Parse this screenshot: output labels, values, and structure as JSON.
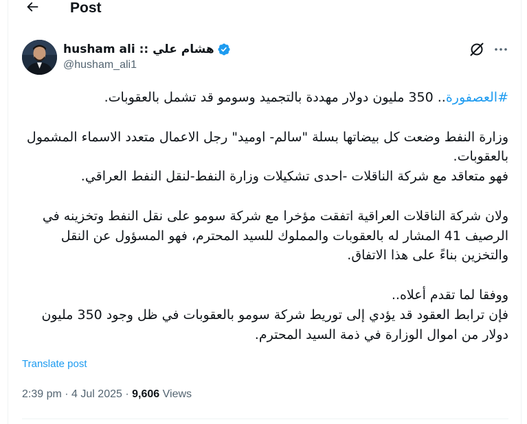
{
  "header": {
    "title": "Post",
    "back_icon": "arrow-left-icon"
  },
  "author": {
    "display_name": "husham ali :: هشام علي",
    "handle": "@husham_ali1",
    "verified_icon": "verified-badge-icon",
    "verified_color": "#1d9bf0"
  },
  "actions": {
    "grok_icon": "grok-icon",
    "more_icon": "more-horizontal-icon"
  },
  "tweet": {
    "hashtag": "#العصفورة",
    "line1_rest": ".. 350 مليون دولار مهددة بالتجميد وسومو قد تشمل بالعقوبات.",
    "para2": "وزارة النفط وضعت كل بيضاتها بسلة \"سالم- اوميد\" رجل الاعمال متعدد الاسماء المشمول بالعقوبات.\nفهو متعاقد مع شركة الناقلات -احدى تشكيلات وزارة النفط-لنقل النفط العراقي.",
    "para3": "ولان شركة الناقلات العراقية اتفقت مؤخرا مع شركة سومو على نقل النفط وتخزينه في الرصيف 41 المشار له بالعقوبات والمملوك للسيد المحترم، فهو المسؤول عن النقل والتخزين بناءً على هذا الاتفاق.",
    "para4": "ووفقا لما تقدم أعلاه..\nفإن ترابط العقود قد يؤدي إلى توريط شركة سومو بالعقوبات في ظل وجود 350 مليون دولار من اموال الوزارة في ذمة السيد المحترم."
  },
  "translate_label": "Translate post",
  "meta": {
    "time": "2:39 pm",
    "separator": "·",
    "date": "4 Jul 2025",
    "views_count": "9,606",
    "views_label": "Views"
  },
  "colors": {
    "accent": "#1d9bf0",
    "text": "#0f1419",
    "secondary": "#536471"
  }
}
